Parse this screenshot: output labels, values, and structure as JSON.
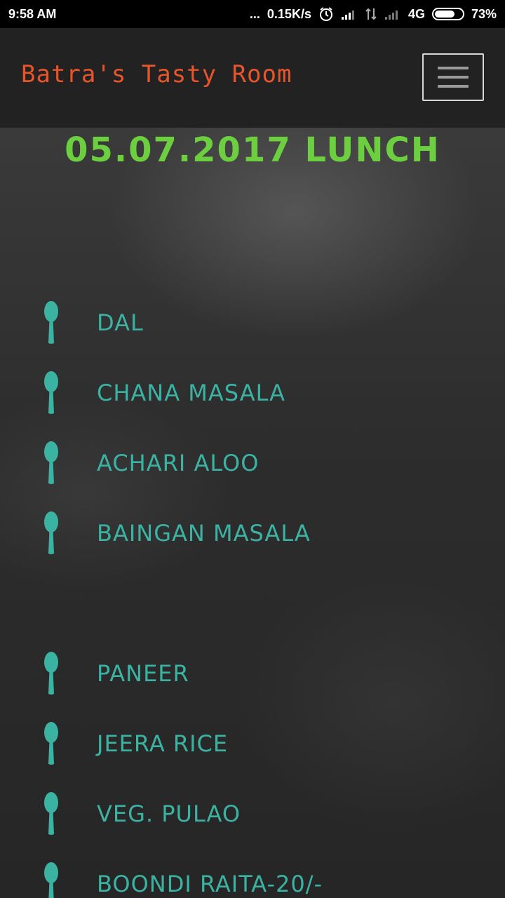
{
  "status_bar": {
    "time": "9:58 AM",
    "dots": "...",
    "speed": "0.15K/s",
    "network": "4G",
    "battery": "73%",
    "battery_level": 0.73
  },
  "header": {
    "brand": "Batra's Tasty Room",
    "menu_icon": "hamburger-icon"
  },
  "menu": {
    "title": "05.07.2017 LUNCH",
    "items": [
      {
        "label": "DAL",
        "icon": "spoon-icon"
      },
      {
        "label": "CHANA MASALA",
        "icon": "spoon-icon"
      },
      {
        "label": "ACHARI ALOO",
        "icon": "spoon-icon"
      },
      {
        "label": "BAINGAN MASALA",
        "icon": "spoon-icon"
      },
      {
        "label": "PANEER",
        "icon": "spoon-icon"
      },
      {
        "label": "JEERA RICE",
        "icon": "spoon-icon"
      },
      {
        "label": "VEG. PULAO",
        "icon": "spoon-icon"
      },
      {
        "label": "BOONDI RAITA-20/-",
        "icon": "spoon-icon"
      }
    ]
  },
  "colors": {
    "brand": "#e8552a",
    "title": "#6ccf3f",
    "item": "#3bb3a3",
    "spoon": "#3bb3a3"
  }
}
